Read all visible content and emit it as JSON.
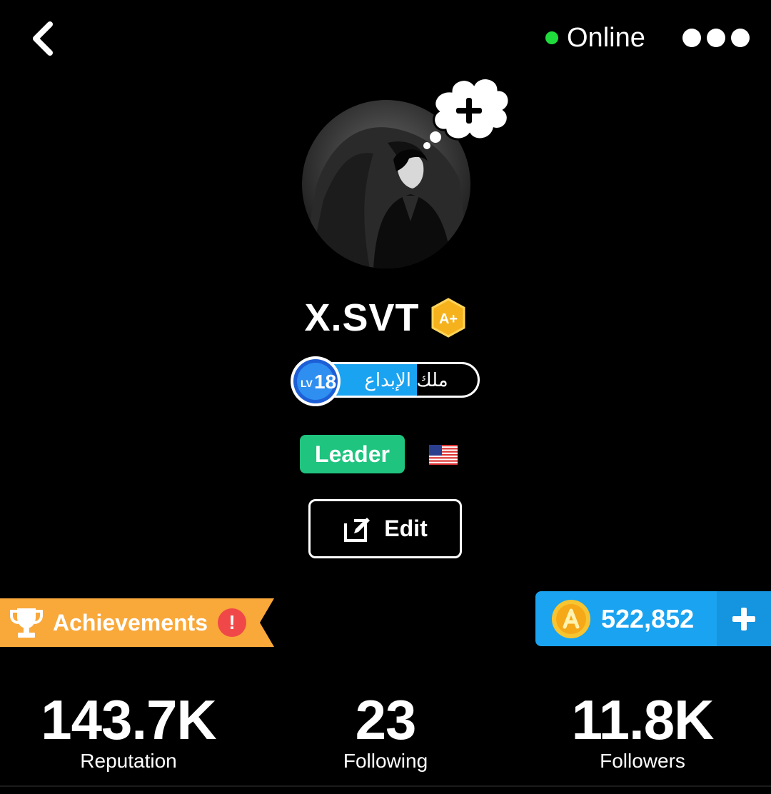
{
  "header": {
    "status": "Online",
    "back_icon": "chevron-left-icon",
    "more_icon": "more-dots-icon",
    "status_color": "#1fdc3c"
  },
  "profile": {
    "username": "X.SVT",
    "verified_badge": "A+",
    "level": "18",
    "level_prefix": "LV",
    "level_title": "ملك الإبداع",
    "level_progress": 0.63,
    "role": "Leader",
    "country_flag": "us-flag-icon",
    "edit_label": "Edit"
  },
  "achievements": {
    "label": "Achievements",
    "alert": "!"
  },
  "coins": {
    "value": "522,852",
    "icon": "amino-coin-icon"
  },
  "stats": [
    {
      "value": "143.7K",
      "label": "Reputation"
    },
    {
      "value": "23",
      "label": "Following"
    },
    {
      "value": "11.8K",
      "label": "Followers"
    }
  ],
  "colors": {
    "background": "#000000",
    "leader": "#1fc47f",
    "coins": "#1aa3f0",
    "achievements": "#f9a83a",
    "alert": "#f04848",
    "badge_gold": "#f5b21c"
  }
}
